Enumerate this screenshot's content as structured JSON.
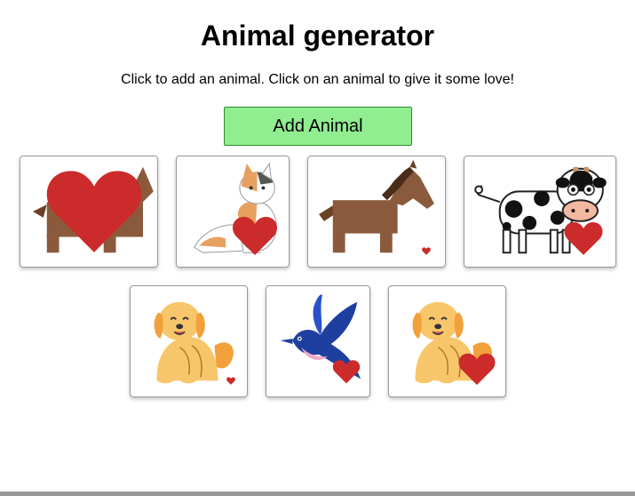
{
  "page": {
    "title": "Animal generator",
    "instructions": "Click to add an animal. Click on an animal to give it some love!"
  },
  "toolbar": {
    "add_label": "Add Animal"
  },
  "colors": {
    "button_bg": "#90ee90",
    "heart": "#cc2b2b",
    "background": "#ffffff"
  },
  "animals": [
    {
      "kind": "horse",
      "icon": "horse-icon",
      "love": "large"
    },
    {
      "kind": "cat",
      "icon": "cat-icon",
      "love": "medium"
    },
    {
      "kind": "horse",
      "icon": "horse-icon",
      "love": "small"
    },
    {
      "kind": "cow",
      "icon": "cow-icon",
      "love": "medium"
    },
    {
      "kind": "dog",
      "icon": "dog-icon",
      "love": "small"
    },
    {
      "kind": "bird",
      "icon": "bird-icon",
      "love": "medium"
    },
    {
      "kind": "dog",
      "icon": "dog-icon",
      "love": "medium"
    }
  ]
}
